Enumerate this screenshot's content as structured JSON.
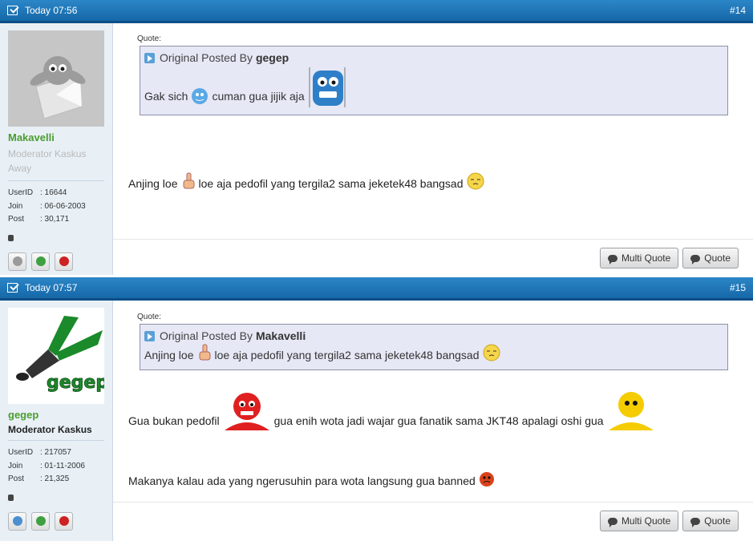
{
  "posts": [
    {
      "timestamp": "Today 07:56",
      "number": "#14",
      "user": {
        "name": "Makavelli",
        "title": "Moderator Kaskus",
        "status": "Away",
        "stats": [
          {
            "key": "UserID",
            "value": ": 16644"
          },
          {
            "key": "Join",
            "value": ": 06-06-2003"
          },
          {
            "key": "Post",
            "value": ": 30,171"
          }
        ]
      },
      "quote": {
        "label": "Quote:",
        "prefix": "Original Posted By",
        "author": "gegep",
        "text_before": "Gak sich",
        "text_middle": "cuman gua jijik aja"
      },
      "message": {
        "part1": "Anjing loe",
        "part2": "loe aja pedofil yang tergila2 sama jeketek48 bangsad"
      },
      "buttons": {
        "multi_quote": "Multi Quote",
        "quote": "Quote"
      }
    },
    {
      "timestamp": "Today 07:57",
      "number": "#15",
      "user": {
        "name": "gegep",
        "title": "Moderator Kaskus",
        "avatar_text": "gegep",
        "stats": [
          {
            "key": "UserID",
            "value": ": 217057"
          },
          {
            "key": "Join",
            "value": ": 01-11-2006"
          },
          {
            "key": "Post",
            "value": ": 21,325"
          }
        ]
      },
      "quote": {
        "label": "Quote:",
        "prefix": "Original Posted By",
        "author": "Makavelli",
        "text_before": "Anjing loe",
        "text_after": "loe aja pedofil yang tergila2 sama jeketek48 bangsad"
      },
      "message": {
        "line1_a": "Gua bukan pedofil",
        "line1_b": "gua enih wota jadi wajar gua fanatik sama JKT48 apalagi oshi gua",
        "line2": "Makanya kalau ada yang ngerusuhin para wota langsung gua banned"
      },
      "buttons": {
        "multi_quote": "Multi Quote",
        "quote": "Quote"
      }
    }
  ],
  "colors": {
    "header": "#1a72b4",
    "username_green": "#4a9d2e",
    "sidebar": "#e8f0f6",
    "quote_bg": "#e6e8f6"
  }
}
